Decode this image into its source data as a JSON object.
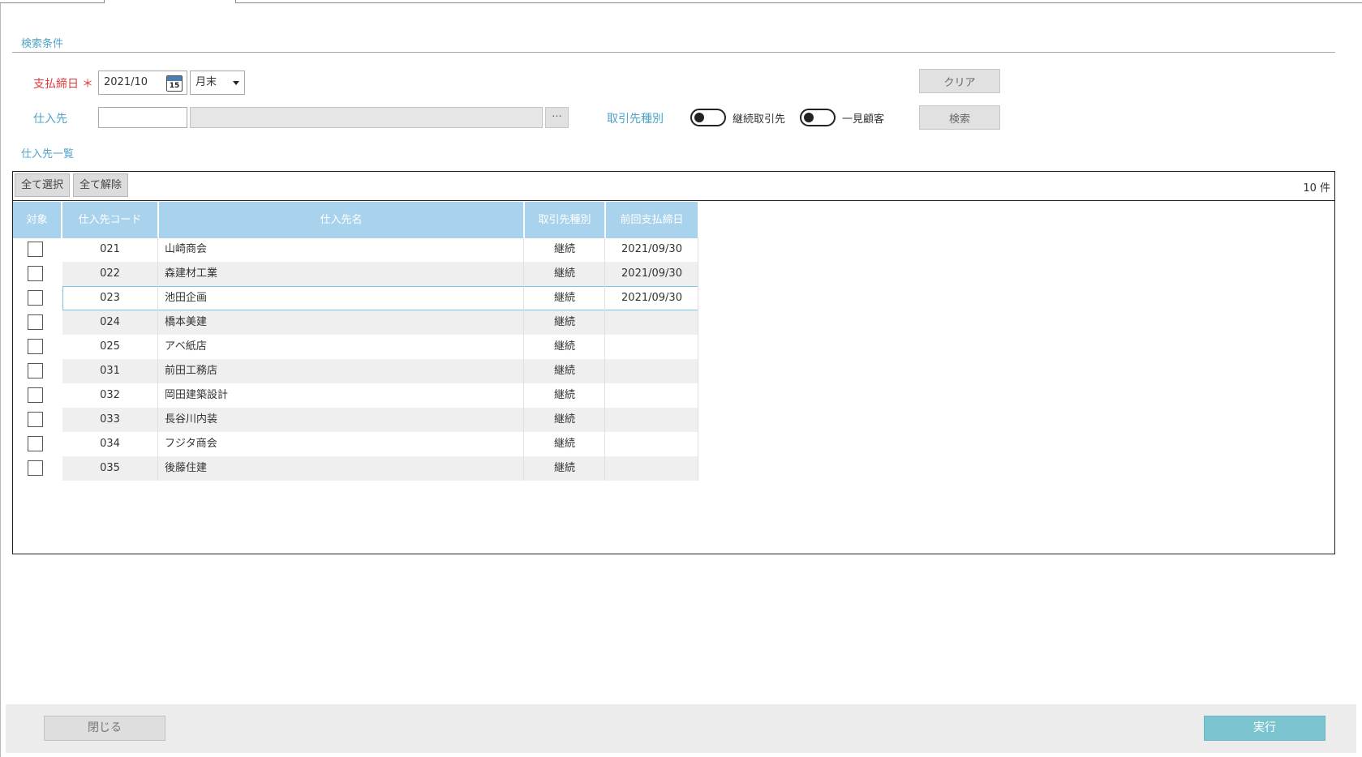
{
  "search_section": {
    "title": "検索条件",
    "payment_close_date": {
      "label": "支払締日",
      "required_mark": "＊",
      "value": "2021/10",
      "calendar_day": "15",
      "select_value": "月末"
    },
    "supplier": {
      "label": "仕入先",
      "code_value": "",
      "name_value": "",
      "lookup_label": "···"
    },
    "partner_type": {
      "label": "取引先種別",
      "options": [
        "継続取引先",
        "一見顧客"
      ]
    },
    "clear_label": "クリア",
    "search_label": "検索"
  },
  "list_section": {
    "title": "仕入先一覧",
    "select_all_label": "全て選択",
    "deselect_all_label": "全て解除",
    "count_text": "10 件",
    "columns": [
      "対象",
      "仕入先コード",
      "仕入先名",
      "取引先種別",
      "前回支払締日"
    ],
    "rows": [
      {
        "checked": false,
        "code": "021",
        "name": "山崎商会",
        "type": "継続",
        "last_date": "2021/09/30"
      },
      {
        "checked": false,
        "code": "022",
        "name": "森建材工業",
        "type": "継続",
        "last_date": "2021/09/30"
      },
      {
        "checked": false,
        "code": "023",
        "name": "池田企画",
        "type": "継続",
        "last_date": "2021/09/30"
      },
      {
        "checked": false,
        "code": "024",
        "name": "橋本美建",
        "type": "継続",
        "last_date": ""
      },
      {
        "checked": false,
        "code": "025",
        "name": "アベ紙店",
        "type": "継続",
        "last_date": ""
      },
      {
        "checked": false,
        "code": "031",
        "name": "前田工務店",
        "type": "継続",
        "last_date": ""
      },
      {
        "checked": false,
        "code": "032",
        "name": "岡田建築設計",
        "type": "継続",
        "last_date": ""
      },
      {
        "checked": false,
        "code": "033",
        "name": "長谷川内装",
        "type": "継続",
        "last_date": ""
      },
      {
        "checked": false,
        "code": "034",
        "name": "フジタ商会",
        "type": "継続",
        "last_date": ""
      },
      {
        "checked": false,
        "code": "035",
        "name": "後藤住建",
        "type": "継続",
        "last_date": ""
      }
    ],
    "selected_row": 2
  },
  "footer": {
    "close_label": "閉じる",
    "execute_label": "実行"
  },
  "colors": {
    "accent": "#4fa3c8",
    "required": "#e23a3a",
    "header_bg": "#a9d3ec",
    "execute_bg": "#7cc4d0"
  }
}
